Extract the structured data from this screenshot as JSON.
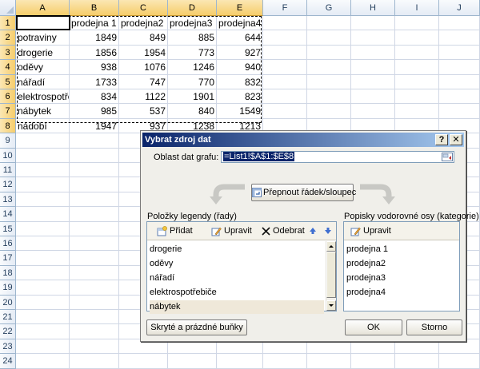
{
  "sheet": {
    "columns": [
      "A",
      "B",
      "C",
      "D",
      "E",
      "F",
      "G",
      "H",
      "I",
      "J"
    ],
    "rows": [
      "1",
      "2",
      "3",
      "4",
      "5",
      "6",
      "7",
      "8",
      "9",
      "10",
      "11",
      "12",
      "13",
      "14",
      "15",
      "16",
      "17",
      "18",
      "19",
      "20",
      "21",
      "22",
      "23",
      "24"
    ],
    "header_row": [
      "",
      "prodejna 1",
      "prodejna2",
      "prodejna3",
      "prodejna4"
    ],
    "data": [
      [
        "potraviny",
        "1849",
        "849",
        "885",
        "644"
      ],
      [
        "drogerie",
        "1856",
        "1954",
        "773",
        "927"
      ],
      [
        "oděvy",
        "938",
        "1076",
        "1246",
        "940"
      ],
      [
        "nářadí",
        "1733",
        "747",
        "770",
        "832"
      ],
      [
        "elektrospotřebiče",
        "834",
        "1122",
        "1901",
        "823"
      ],
      [
        "nábytek",
        "985",
        "537",
        "840",
        "1549"
      ],
      [
        "nádobí",
        "1947",
        "937",
        "1238",
        "1213"
      ]
    ]
  },
  "dialog": {
    "title": "Vybrat zdroj dat",
    "help_btn": "?",
    "close_btn": "✕",
    "range_label": "Oblast dat grafu:",
    "range_value": "=List1!$A$1:$E$8",
    "switch_btn": "Přepnout řádek/sloupec",
    "legend_label": "Položky legendy (řady)",
    "add_btn": "Přidat",
    "edit_btn": "Upravit",
    "remove_btn": "Odebrat",
    "series": [
      "drogerie",
      "oděvy",
      "nářadí",
      "elektrospotřebiče",
      "nábytek"
    ],
    "axis_label": "Popisky vodorovné osy (kategorie)",
    "axis_edit_btn": "Upravit",
    "categories": [
      "prodejna 1",
      "prodejna2",
      "prodejna3",
      "prodejna4"
    ],
    "hidden_btn": "Skryté a prázdné buňky",
    "ok_btn": "OK",
    "cancel_btn": "Storno"
  },
  "colors": {
    "title_start": "#0a246a",
    "title_end": "#a6caf0",
    "header_selected": "#f6cd6b",
    "dialog_bg": "#f0efea"
  }
}
